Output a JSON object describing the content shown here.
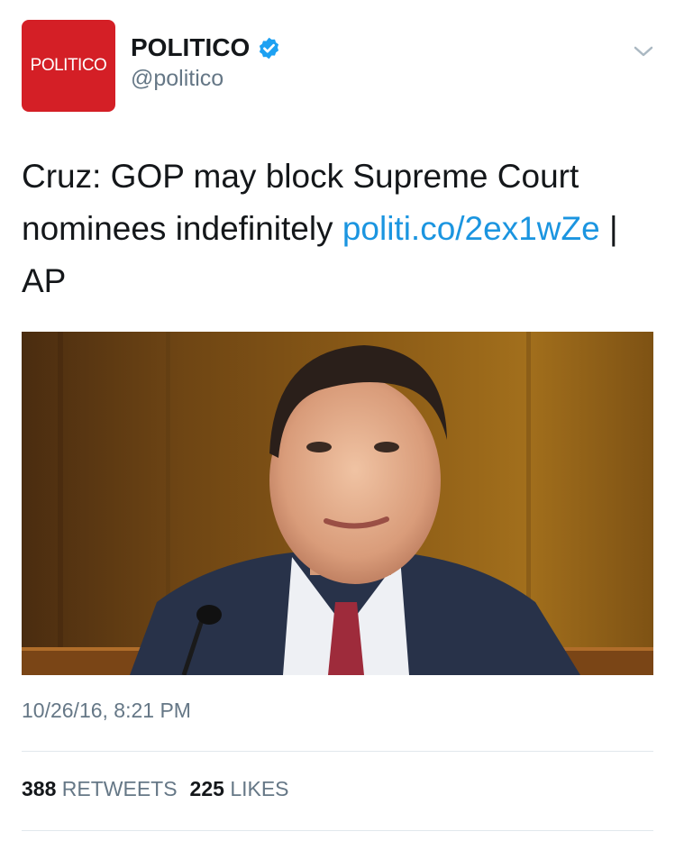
{
  "account": {
    "avatar_text": "POLITICO",
    "display_name": "POLITICO",
    "handle": "@politico",
    "brand_color": "#d41f26",
    "verified_color": "#1da1f2"
  },
  "tweet": {
    "text_before_link": "Cruz: GOP may block Supreme Court nominees indefinitely ",
    "link_text": "politi.co/2ex1wZe",
    "text_after_link": " | AP",
    "link_color": "#1b95e0",
    "media_description": "photo",
    "timestamp": "10/26/16, 8:21 PM"
  },
  "stats": {
    "retweets_count": "388",
    "retweets_label": "RETWEETS",
    "likes_count": "225",
    "likes_label": "LIKES"
  },
  "icons": {
    "verified": "verified-badge-icon",
    "menu": "chevron-down-icon"
  }
}
